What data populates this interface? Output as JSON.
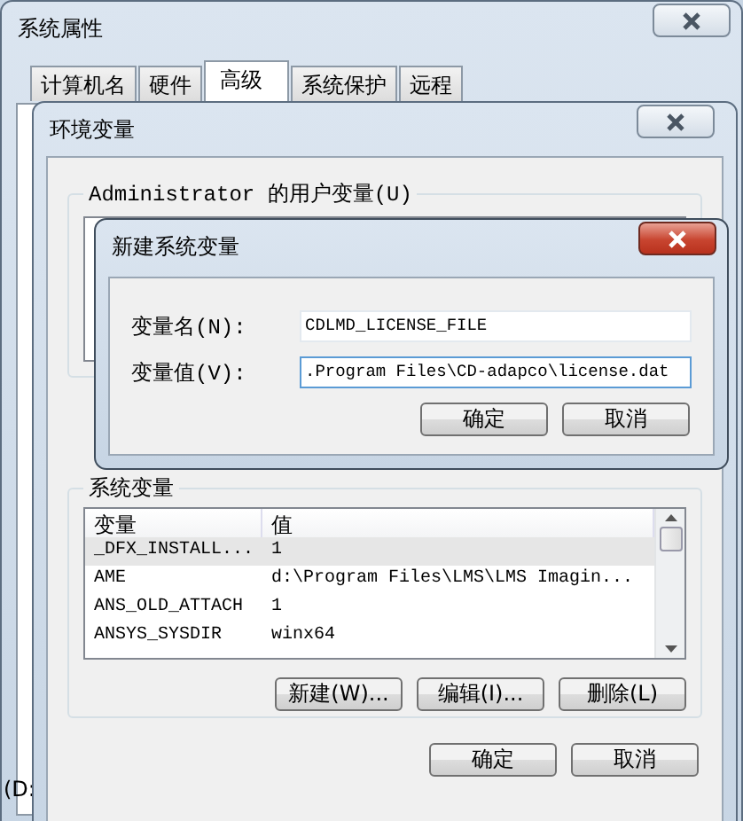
{
  "system_properties": {
    "title": "系统属性",
    "tabs": [
      {
        "label": "计算机名",
        "selected": false
      },
      {
        "label": "硬件",
        "selected": false
      },
      {
        "label": "高级",
        "selected": true
      },
      {
        "label": "系统保护",
        "selected": false
      },
      {
        "label": "远程",
        "selected": false
      }
    ],
    "partial_text": "(D:"
  },
  "environment_variables": {
    "title": "环境变量",
    "user_group": {
      "label": "Administrator 的用户变量(U)"
    },
    "system_group": {
      "label": "系统变量",
      "columns": [
        "变量",
        "值"
      ],
      "rows": [
        {
          "name": "_DFX_INSTALL...",
          "value": "1",
          "selected": true
        },
        {
          "name": "AME",
          "value": "d:\\Program Files\\LMS\\LMS Imagin...",
          "selected": false
        },
        {
          "name": "ANS_OLD_ATTACH",
          "value": "1",
          "selected": false
        },
        {
          "name": "ANSYS_SYSDIR",
          "value": "winx64",
          "selected": false
        }
      ],
      "buttons": [
        "新建(W)...",
        "编辑(I)...",
        "删除(L)"
      ]
    },
    "buttons": [
      "确定",
      "取消"
    ]
  },
  "new_variable_dialog": {
    "title": "新建系统变量",
    "fields": [
      {
        "label": "变量名(N):",
        "value": "CDLMD_LICENSE_FILE",
        "focused": false
      },
      {
        "label": "变量值(V):",
        "value": ".Program Files\\CD-adapco\\license.dat",
        "focused": true
      }
    ],
    "buttons": [
      "确定",
      "取消"
    ]
  }
}
